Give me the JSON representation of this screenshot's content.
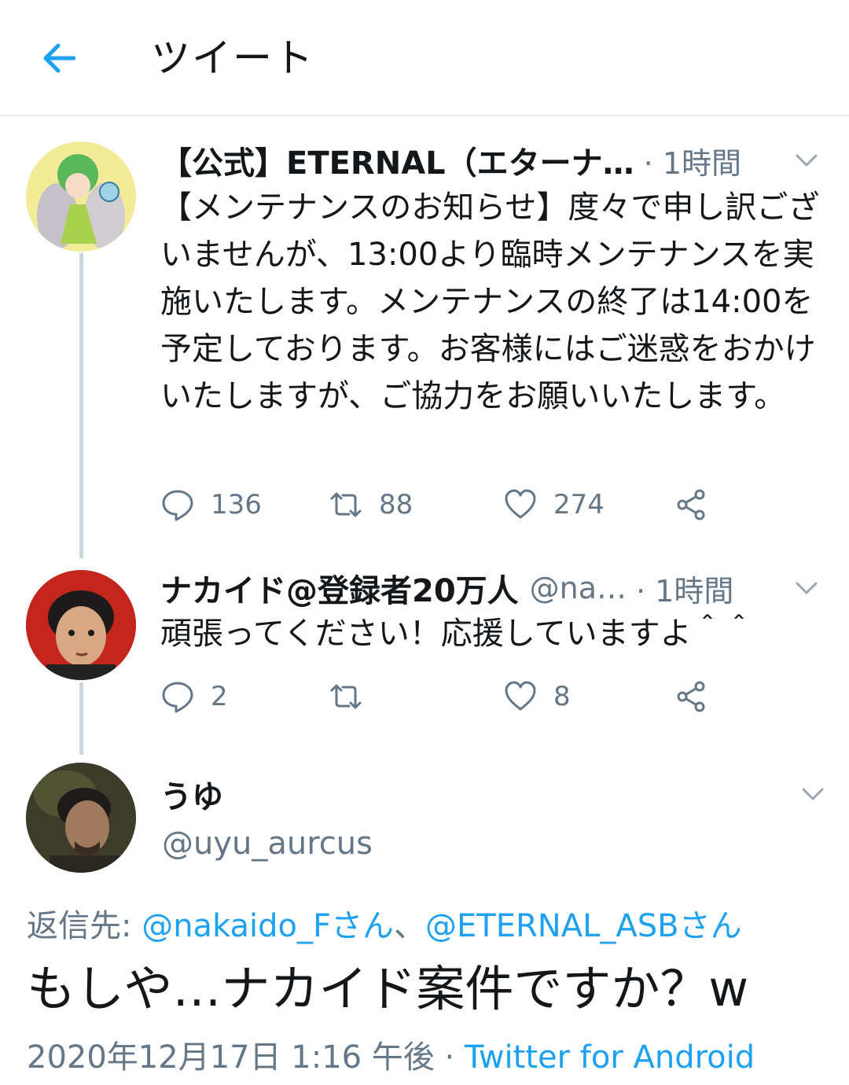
{
  "header": {
    "title": "ツイート",
    "back_icon": "arrow-left-icon",
    "accent": "#1da1f2"
  },
  "tweets": [
    {
      "name": "【公式】ETERNAL（エターナ…",
      "time": "· 1時間",
      "text": "【メンテナンスのお知らせ】度々で申し訳ございませんが、13:00より臨時メンテナンスを実施いたします。メンテナンスの終了は14:00を予定しております。お客様にはご迷惑をおかけいたしますが、ご協力をお願いいたします。",
      "reply_count": "136",
      "retweet_count": "88",
      "like_count": "274"
    },
    {
      "name": "ナカイド@登録者20万人",
      "handle": "@na…",
      "time": "· 1時間",
      "text": "頑張ってください！応援していますよ＾＾",
      "reply_count": "2",
      "retweet_count": "",
      "like_count": "8"
    }
  ],
  "main": {
    "name": "うゆ",
    "handle": "@uyu_aurcus",
    "reply_prefix": "返信先: ",
    "reply_user1": "@nakaido_Fさん",
    "reply_sep": "、",
    "reply_user2": "@ETERNAL_ASBさん",
    "text": "もしや…ナカイド案件ですか？w",
    "timestamp": "2020年12月17日 1:16 午後 · ",
    "source": "Twitter for Android"
  },
  "colors": {
    "text": "#14171a",
    "muted": "#657786",
    "link": "#1da1f2",
    "divider": "#e6ecf0"
  }
}
